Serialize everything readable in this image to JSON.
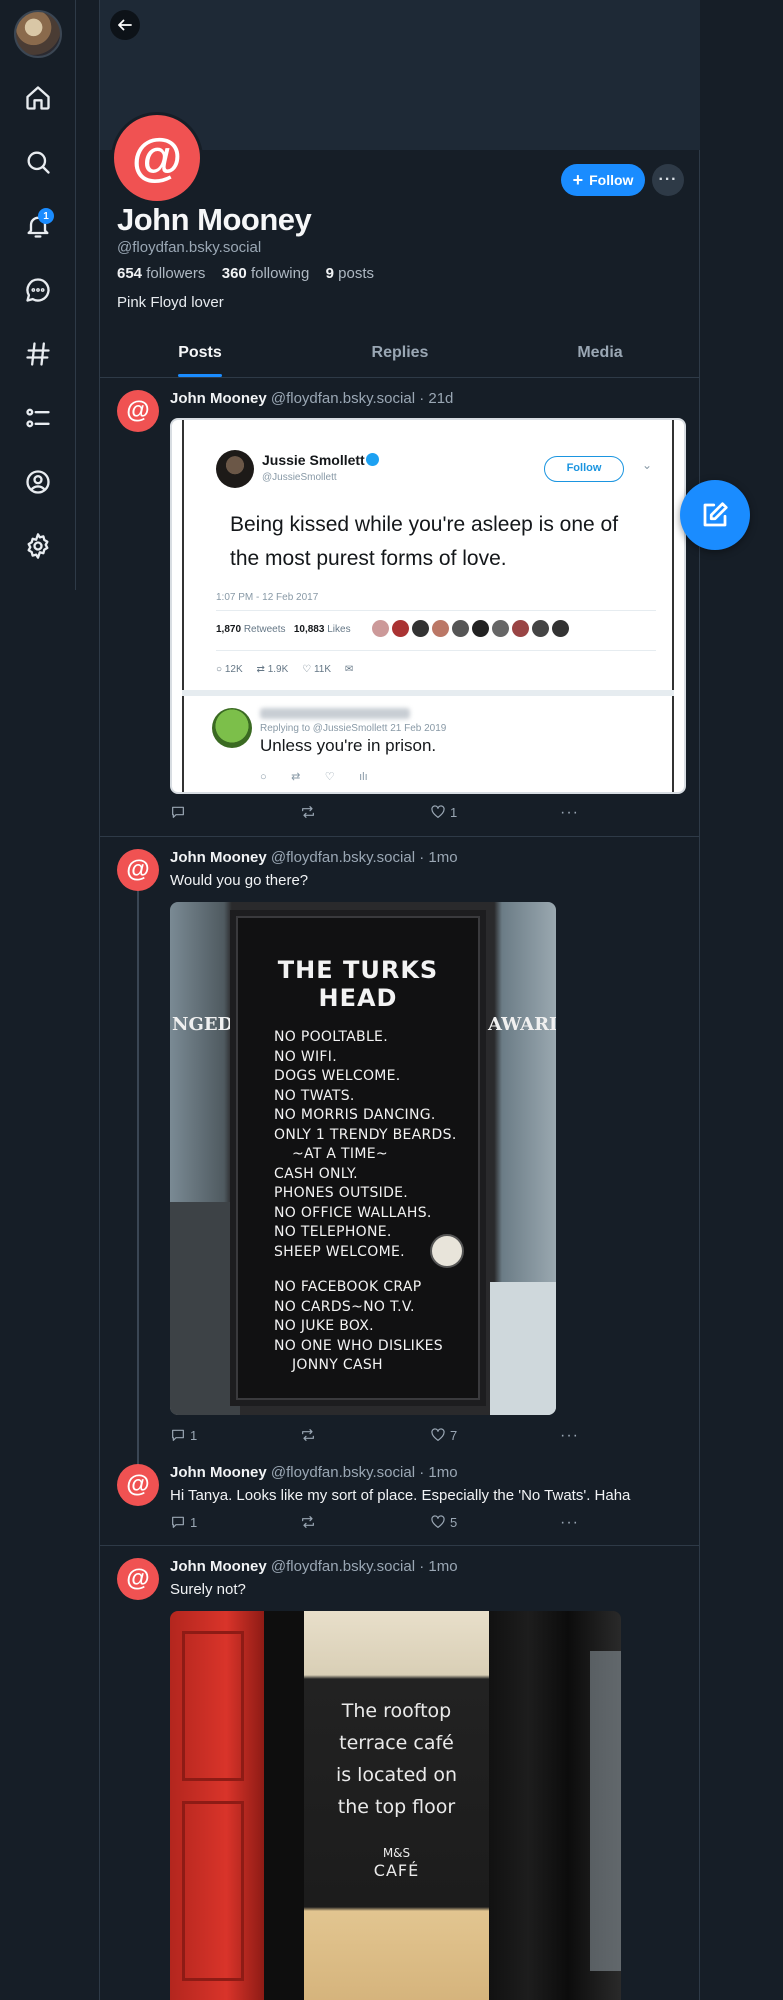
{
  "nav": {
    "items": [
      {
        "name": "home",
        "icon": "home-icon"
      },
      {
        "name": "search",
        "icon": "search-icon"
      },
      {
        "name": "notifications",
        "icon": "bell-icon",
        "badge": "1"
      },
      {
        "name": "chat",
        "icon": "chat-bubble-icon"
      },
      {
        "name": "feeds",
        "icon": "hashtag-icon"
      },
      {
        "name": "lists",
        "icon": "list-icon"
      },
      {
        "name": "profile",
        "icon": "user-circle-icon"
      },
      {
        "name": "settings",
        "icon": "gear-icon"
      }
    ]
  },
  "profile": {
    "avatar_glyph": "@",
    "display_name": "John Mooney",
    "handle": "@floydfan.bsky.social",
    "followers_count": "654",
    "followers_label": "followers",
    "following_count": "360",
    "following_label": "following",
    "posts_count": "9",
    "posts_label": "posts",
    "bio": "Pink Floyd lover",
    "follow_label": "Follow",
    "more_label": "···",
    "accent_color": "#1a8cff",
    "avatar_color": "#f05252"
  },
  "tabs": [
    {
      "label": "Posts",
      "active": true
    },
    {
      "label": "Replies",
      "active": false
    },
    {
      "label": "Media",
      "active": false
    }
  ],
  "posts": [
    {
      "author": "John Mooney",
      "handle": "@floydfan.bsky.social",
      "age": "· 21d",
      "text": "",
      "replies": "",
      "likes": "1",
      "embedded_tweet": {
        "name": "Jussie Smollett",
        "handle": "@JussieSmollett",
        "follow": "Follow",
        "text": "Being kissed while you're asleep is one of the most purest forms of love.",
        "time": "1:07 PM - 12 Feb 2017",
        "retweets_count": "1,870",
        "retweets_label": "Retweets",
        "likes_count": "10,883",
        "likes_label": "Likes",
        "reply_count": "12K",
        "rt_count": "1.9K",
        "heart_count": "11K",
        "reply_meta": "Replying to @JussieSmollett  21 Feb 2019",
        "reply_text": "Unless you're in prison."
      }
    },
    {
      "author": "John Mooney",
      "handle": "@floydfan.bsky.social",
      "age": "· 1mo",
      "text": "Would you go there?",
      "replies": "1",
      "likes": "7",
      "sign": {
        "title": "THE TURKS HEAD",
        "left_text": "NGED",
        "right_text": "AWARD",
        "lines": [
          "NO POOLTABLE.",
          "NO WIFI.",
          "DOGS WELCOME.",
          "NO TWATS.",
          "NO MORRIS DANCING.",
          "ONLY 1 TRENDY BEARDS.",
          "~AT A TIME~",
          "CASH ONLY.",
          "PHONES OUTSIDE.",
          "NO OFFICE WALLAHS.",
          "NO TELEPHONE.",
          "SHEEP WELCOME.",
          "",
          "NO FACEBOOK CRAP",
          "NO CARDS~NO T.V.",
          "NO JUKE BOX.",
          "NO ONE WHO DISLIKES",
          "JONNY CASH"
        ]
      }
    },
    {
      "author": "John Mooney",
      "handle": "@floydfan.bsky.social",
      "age": "· 1mo",
      "text": "Hi Tanya. Looks like my sort of place. Especially the 'No Twats'. Haha",
      "replies": "1",
      "likes": "5"
    },
    {
      "author": "John Mooney",
      "handle": "@floydfan.bsky.social",
      "age": "· 1mo",
      "text": "Surely not?",
      "door": {
        "sign_lines": [
          "The rooftop",
          "terrace café",
          "is located on",
          "the top floor"
        ],
        "brand": "M&S",
        "cafe": "CAFÉ"
      }
    }
  ]
}
